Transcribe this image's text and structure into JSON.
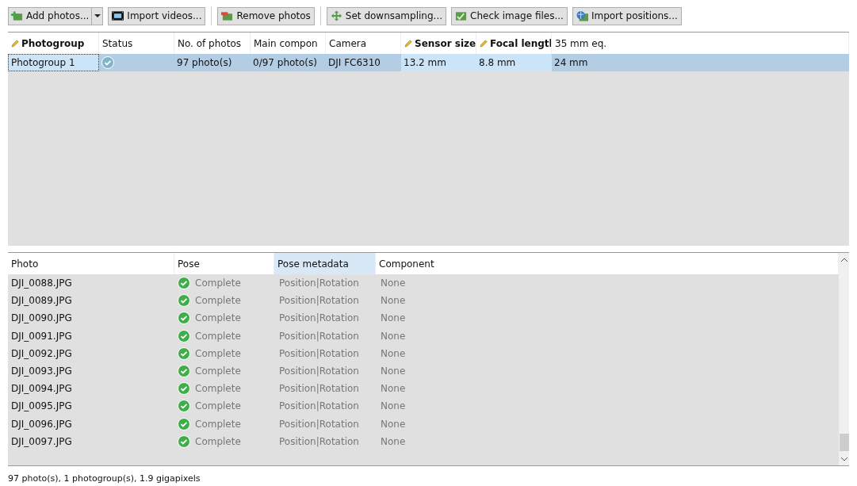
{
  "toolbar": [
    {
      "label": "Add photos...",
      "kind": "split"
    },
    {
      "label": "Import videos...",
      "kind": "button"
    },
    {
      "label": "Remove photos",
      "kind": "button"
    },
    {
      "label": "Set downsampling...",
      "kind": "button"
    },
    {
      "label": "Check image files...",
      "kind": "button"
    },
    {
      "label": "Import positions...",
      "kind": "button"
    }
  ],
  "photogroups": {
    "columns": [
      {
        "label": "Photogroup",
        "editable": true
      },
      {
        "label": "Status",
        "editable": false
      },
      {
        "label": "No. of photos",
        "editable": false
      },
      {
        "label": "Main compon",
        "editable": false
      },
      {
        "label": "Camera",
        "editable": false
      },
      {
        "label": "Sensor size",
        "editable": true
      },
      {
        "label": "Focal lengtl",
        "editable": true
      },
      {
        "label": "35 mm eq.",
        "editable": false
      }
    ],
    "rows": [
      {
        "selected": true,
        "cells": [
          "Photogroup 1",
          {
            "kind": "status",
            "ok": true
          },
          "97 photo(s)",
          "0/97 photo(s)",
          "DJI FC6310",
          "13.2 mm",
          "8.8 mm",
          "24 mm"
        ]
      }
    ]
  },
  "photos": {
    "columns": [
      {
        "label": "Photo",
        "selected": false
      },
      {
        "label": "Pose",
        "selected": false
      },
      {
        "label": "Pose metadata",
        "selected": true
      },
      {
        "label": "Component",
        "selected": false
      }
    ],
    "rows": [
      [
        "DJI_0088.JPG",
        "Complete",
        "Position|Rotation",
        "None"
      ],
      [
        "DJI_0089.JPG",
        "Complete",
        "Position|Rotation",
        "None"
      ],
      [
        "DJI_0090.JPG",
        "Complete",
        "Position|Rotation",
        "None"
      ],
      [
        "DJI_0091.JPG",
        "Complete",
        "Position|Rotation",
        "None"
      ],
      [
        "DJI_0092.JPG",
        "Complete",
        "Position|Rotation",
        "None"
      ],
      [
        "DJI_0093.JPG",
        "Complete",
        "Position|Rotation",
        "None"
      ],
      [
        "DJI_0094.JPG",
        "Complete",
        "Position|Rotation",
        "None"
      ],
      [
        "DJI_0095.JPG",
        "Complete",
        "Position|Rotation",
        "None"
      ],
      [
        "DJI_0096.JPG",
        "Complete",
        "Position|Rotation",
        "None"
      ],
      [
        "DJI_0097.JPG",
        "Complete",
        "Position|Rotation",
        "None"
      ]
    ]
  },
  "status_bar": "97 photo(s), 1 photogroup(s), 1.9 gigapixels"
}
